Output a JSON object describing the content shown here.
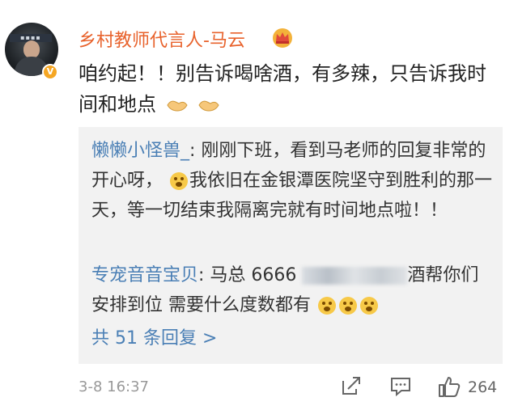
{
  "post": {
    "username": "乡村教师代言人-马云",
    "badge": "V",
    "text": "咱约起！！别告诉喝啥酒，有多辣，只告诉我时间和地点",
    "time": "3-8 16:37",
    "likes": "264"
  },
  "replies": [
    {
      "user": "懒懒小怪兽_",
      "sep": ": ",
      "text_a": "刚刚下班，看到马老师的回复非常的开心呀，",
      "text_b": "我依旧在金银潭医院坚守到胜利的那一天，等一切结束我隔离完就有时间地点啦！！"
    },
    {
      "user": "专宠音音宝贝",
      "sep": ": ",
      "text_a": "马总 6666 ",
      "text_b": "酒帮你们安排到位 需要什么度数都有"
    }
  ],
  "more_replies": "共 51 条回复 >",
  "colors": {
    "username": "#e8622c",
    "link": "#4a7fb5",
    "reply_bg": "#f2f2f2",
    "verified": "#f5a623"
  },
  "icons": [
    "crown-icon",
    "handshake-icon",
    "share-icon",
    "comment-icon",
    "like-icon",
    "verified-icon"
  ]
}
